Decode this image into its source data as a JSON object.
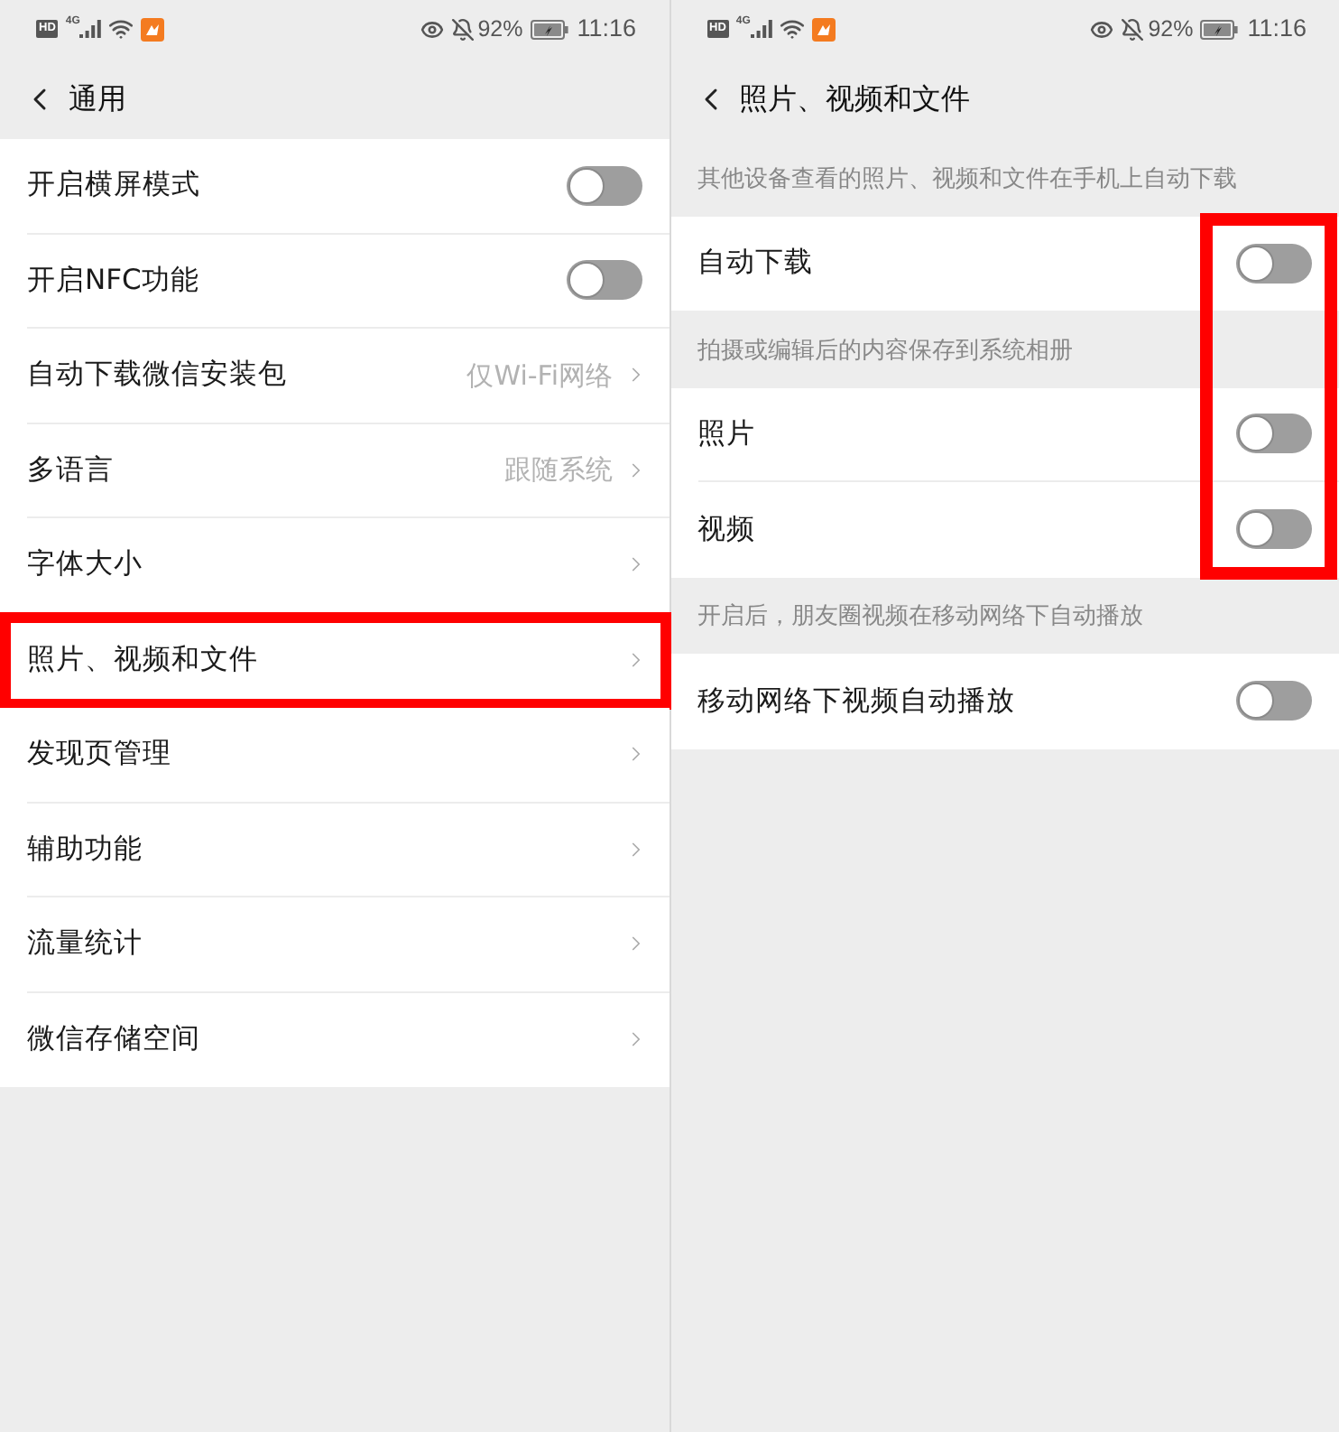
{
  "screens": [
    {
      "status_bar": {
        "hd": "HD",
        "network": "4G",
        "battery": "92%",
        "time": "11:16"
      },
      "nav_bar": {
        "title": "通用"
      },
      "sections": [
        {
          "items": [
            {
              "kind": "switch",
              "label": "开启横屏模式",
              "on": false,
              "highlighted": false
            },
            {
              "kind": "switch",
              "label": "开启NFC功能",
              "on": false,
              "highlighted": false
            },
            {
              "kind": "link",
              "label": "自动下载微信安装包",
              "value": "仅Wi-Fi网络",
              "highlighted": false
            },
            {
              "kind": "link",
              "label": "多语言",
              "value": "跟随系统",
              "highlighted": false
            },
            {
              "kind": "link",
              "label": "字体大小",
              "highlighted": false
            },
            {
              "kind": "link",
              "label": "照片、视频和文件",
              "highlighted": true
            },
            {
              "kind": "link",
              "label": "发现页管理",
              "highlighted": false
            },
            {
              "kind": "link",
              "label": "辅助功能",
              "highlighted": false
            },
            {
              "kind": "link",
              "label": "流量统计",
              "highlighted": false
            },
            {
              "kind": "link",
              "label": "微信存储空间",
              "highlighted": false
            }
          ]
        }
      ]
    },
    {
      "status_bar": {
        "hd": "HD",
        "network": "4G",
        "battery": "92%",
        "time": "11:16"
      },
      "nav_bar": {
        "title": "照片、视频和文件"
      },
      "sections": [
        {
          "header": "其他设备查看的照片、视频和文件在手机上自动下载",
          "items": [
            {
              "kind": "switch",
              "label": "自动下载",
              "on": false,
              "highlighted": true
            }
          ]
        },
        {
          "header": "拍摄或编辑后的内容保存到系统相册",
          "items": [
            {
              "kind": "switch",
              "label": "照片",
              "on": false,
              "highlighted": true
            },
            {
              "kind": "switch",
              "label": "视频",
              "on": false,
              "highlighted": true
            }
          ]
        },
        {
          "header": "开启后，朋友圈视频在移动网络下自动播放",
          "items": [
            {
              "kind": "switch",
              "label": "移动网络下视频自动播放",
              "on": false,
              "highlighted": false
            }
          ]
        }
      ]
    }
  ]
}
